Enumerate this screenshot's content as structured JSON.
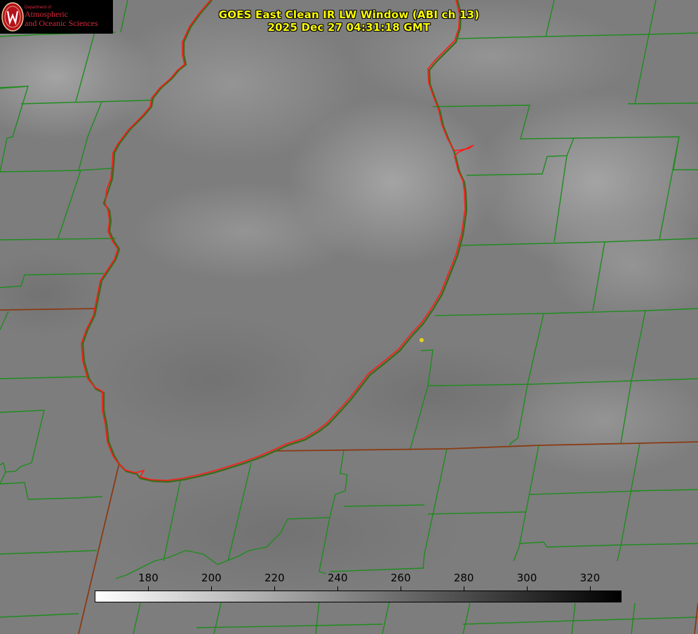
{
  "title": {
    "line1": "GOES East Clean IR LW Window (ABI ch 13)",
    "line2": "2025 Dec 27 04:31:18 GMT"
  },
  "logo": {
    "department": "Department of",
    "line1": "Atmospheric",
    "line2": "and Oceanic Sciences",
    "seal_letter": "W"
  },
  "colorbar": {
    "ticks": [
      "180",
      "200",
      "220",
      "240",
      "260",
      "280",
      "300",
      "320"
    ],
    "tick_values": [
      180,
      200,
      220,
      240,
      260,
      280,
      300,
      320
    ],
    "range": [
      163,
      330
    ],
    "gradient_from": "#ffffff",
    "gradient_to": "#000000"
  },
  "colors": {
    "background_gray": "#7c7c7c",
    "boundary_green": "#1e8c1e",
    "lakeshore_red": "#ff1a1a",
    "title_yellow": "#ffff00",
    "station_marker": "#e6d21e"
  },
  "markers": [
    {
      "name": "station-marker",
      "color": "#e6d21e"
    }
  ]
}
